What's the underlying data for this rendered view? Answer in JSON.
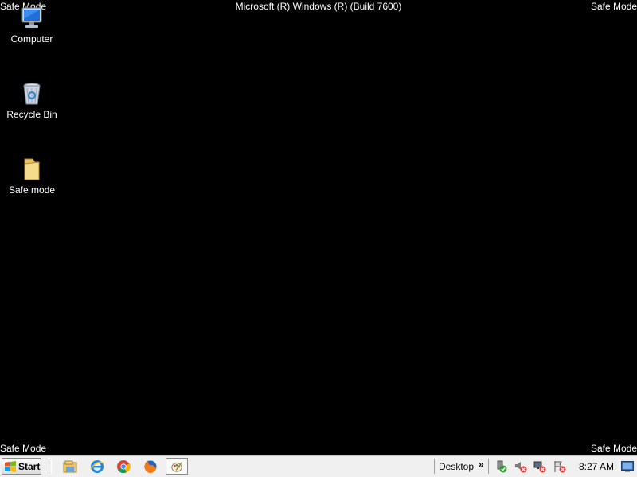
{
  "watermark": {
    "top_left": "Safe Mode",
    "top_right": "Safe Mode",
    "bottom_left": "Safe Mode",
    "bottom_right": "Safe Mode",
    "build": "Microsoft (R) Windows (R) (Build 7600)"
  },
  "desktop": {
    "icons": [
      {
        "label": "Computer",
        "icon": "computer-icon"
      },
      {
        "label": "Recycle Bin",
        "icon": "recycle-bin-icon"
      },
      {
        "label": "Safe mode",
        "icon": "folder-icon"
      }
    ]
  },
  "taskbar": {
    "start_label": "Start",
    "quick_launch": [
      "file-explorer-icon",
      "internet-explorer-icon",
      "chrome-icon",
      "firefox-icon",
      "paint-icon"
    ],
    "toolbar_label": "Desktop",
    "overflow": "»",
    "tray_icons": [
      "safely-remove-hardware-icon",
      "volume-muted-icon",
      "network-disconnected-icon",
      "action-center-error-icon"
    ],
    "clock": "8:27 AM"
  },
  "colors": {
    "desktop_bg": "#000000",
    "taskbar_bg": "#f0f0f0"
  }
}
